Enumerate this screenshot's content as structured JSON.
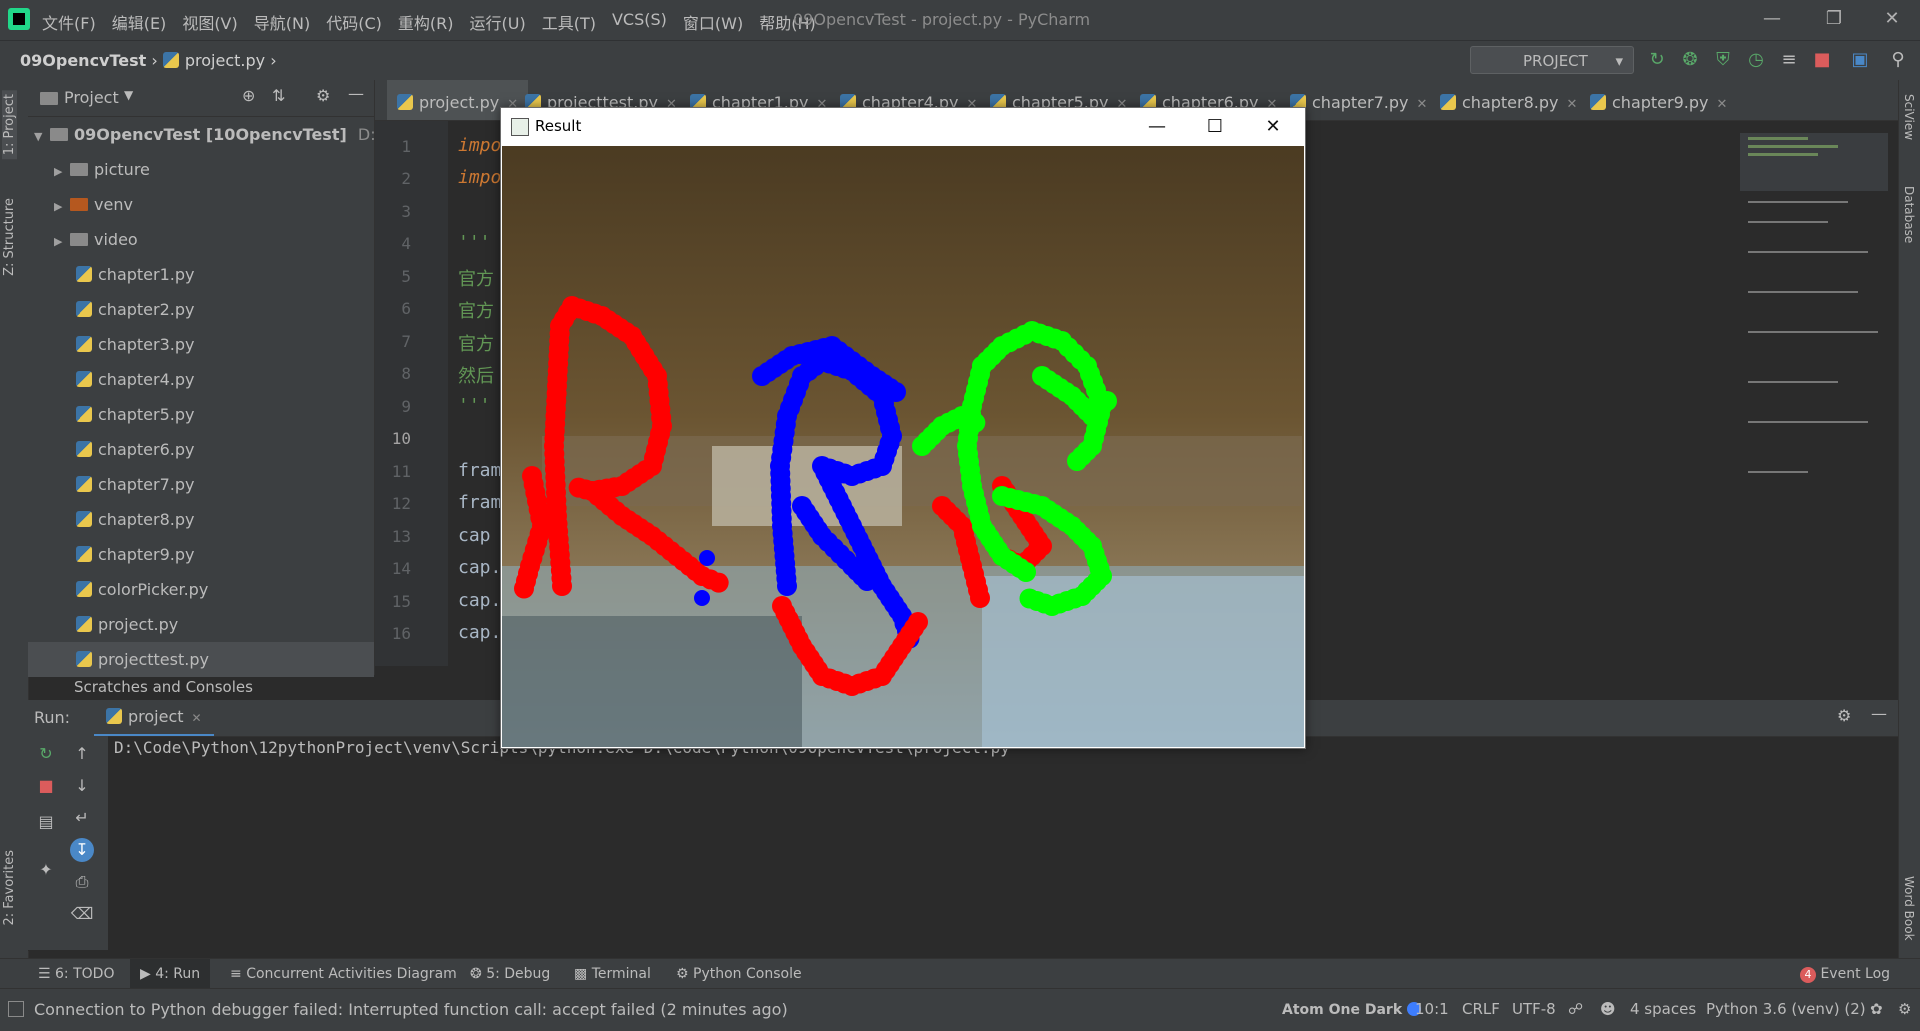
{
  "window": {
    "title": "09OpencvTest - project.py - PyCharm",
    "menu": [
      "文件(F)",
      "编辑(E)",
      "视图(V)",
      "导航(N)",
      "代码(C)",
      "重构(R)",
      "运行(U)",
      "工具(T)",
      "VCS(S)",
      "窗口(W)",
      "帮助(H)"
    ]
  },
  "navbar": {
    "project": "09OpencvTest",
    "file": "project.py",
    "run_config": "PROJECT"
  },
  "left_stripe": {
    "project_tab": "1: Project",
    "structure_tab": "Z: Structure",
    "favorites_tab": "2: Favorites"
  },
  "right_stripe": {
    "sciview": "SciView",
    "database": "Database",
    "wordbook": "Word Book"
  },
  "project_panel": {
    "header": "Project",
    "root": "09OpencvTest [10OpencvTest]",
    "root_path": "D:\\Code",
    "folders": [
      "picture",
      "venv",
      "video"
    ],
    "files": [
      "chapter1.py",
      "chapter2.py",
      "chapter3.py",
      "chapter4.py",
      "chapter5.py",
      "chapter6.py",
      "chapter7.py",
      "chapter8.py",
      "chapter9.py",
      "colorPicker.py",
      "project.py",
      "projecttest.py"
    ],
    "scratches": "Scratches and Consoles"
  },
  "editor_tabs": [
    "project.py",
    "projecttest.py",
    "chapter1.py",
    "chapter4.py",
    "chapter5.py",
    "chapter6.py",
    "chapter7.py",
    "chapter8.py",
    "chapter9.py"
  ],
  "editor": {
    "line_numbers": [
      "1",
      "2",
      "3",
      "4",
      "5",
      "6",
      "7",
      "8",
      "9",
      "10",
      "11",
      "12",
      "13",
      "14",
      "15",
      "16"
    ],
    "lines": [
      "impo",
      "impo",
      "",
      "'''",
      "官方",
      "官方",
      "官方",
      "然后",
      "'''",
      "",
      "fram",
      "fram",
      "cap",
      "cap.",
      "cap.",
      "cap."
    ],
    "current_line": "10"
  },
  "run_panel": {
    "label": "Run:",
    "tab": "project",
    "command": "D:\\Code\\Python\\12pythonProject\\venv\\Scripts\\python.exe D:\\Code\\Python\\09OpencvTest\\project.py"
  },
  "bottom_tabs": [
    "6: TODO",
    "4: Run",
    "Concurrent Activities Diagram",
    "5: Debug",
    "Terminal",
    "Python Console"
  ],
  "event_log": {
    "count": "4",
    "label": "Event Log"
  },
  "status_bar": {
    "message": "Connection to Python debugger failed: Interrupted function call: accept failed (2 minutes ago)",
    "theme": "Atom One Dark",
    "position": "10:1",
    "line_sep": "CRLF",
    "encoding": "UTF-8",
    "indent": "4 spaces",
    "interpreter": "Python 3.6 (venv) (2)"
  },
  "result_window": {
    "title": "Result",
    "stroke_colors": {
      "red": "#ff0000",
      "blue": "#0000ff",
      "green": "#00ff00"
    }
  },
  "colors": {
    "accent": "#4a88c7",
    "ide_bg": "#2b2b2b",
    "panel_bg": "#3c3f41"
  }
}
